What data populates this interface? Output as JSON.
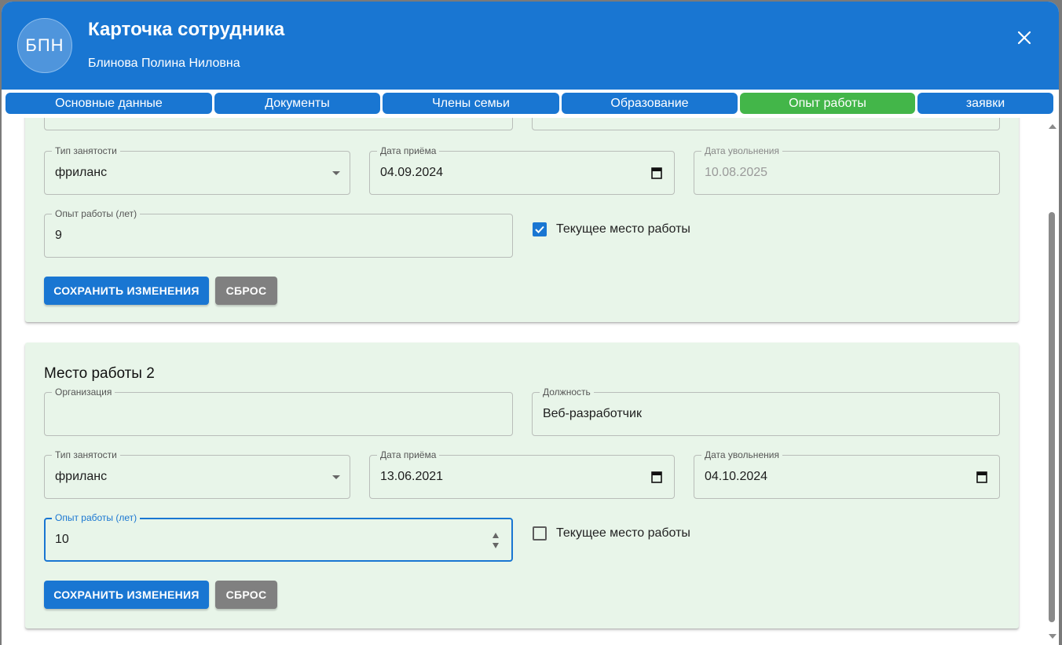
{
  "header": {
    "avatar_initials": "БПН",
    "title": "Карточка сотрудника",
    "subtitle": "Блинова Полина Ниловна",
    "close_icon": "close-icon"
  },
  "tabs": [
    {
      "label": "Основные данные",
      "active": false
    },
    {
      "label": "Документы",
      "active": false
    },
    {
      "label": "Члены семьи",
      "active": false
    },
    {
      "label": "Образование",
      "active": false
    },
    {
      "label": "Опыт работы",
      "active": true
    },
    {
      "label": "заявки",
      "active": false
    }
  ],
  "job1": {
    "employment_type": {
      "label": "Тип занятости",
      "value": "фриланс"
    },
    "hire_date": {
      "label": "Дата приёма",
      "value": "04.09.2024"
    },
    "dismissal_date": {
      "label": "Дата увольнения",
      "value": "10.08.2025",
      "disabled": true
    },
    "experience": {
      "label": "Опыт работы (лет)",
      "value": "9"
    },
    "current_job": {
      "label": "Текущее место работы",
      "checked": true
    },
    "save_label": "СОХРАНИТЬ ИЗМЕНЕНИЯ",
    "reset_label": "СБРОС"
  },
  "job2": {
    "title": "Место работы 2",
    "organization": {
      "label": "Организация",
      "value": ""
    },
    "position": {
      "label": "Должность",
      "value": "Веб-разработчик"
    },
    "employment_type": {
      "label": "Тип занятости",
      "value": "фриланс"
    },
    "hire_date": {
      "label": "Дата приёма",
      "value": "13.06.2021"
    },
    "dismissal_date": {
      "label": "Дата увольнения",
      "value": "04.10.2024"
    },
    "experience": {
      "label": "Опыт работы (лет)",
      "value": "10",
      "focused": true
    },
    "current_job": {
      "label": "Текущее место работы",
      "checked": false
    },
    "save_label": "СОХРАНИТЬ ИЗМЕНЕНИЯ",
    "reset_label": "СБРОС"
  },
  "colors": {
    "primary": "#1976d2",
    "active_tab": "#43b649",
    "card_bg": "#e8f5e9",
    "reset_button": "#808080"
  }
}
